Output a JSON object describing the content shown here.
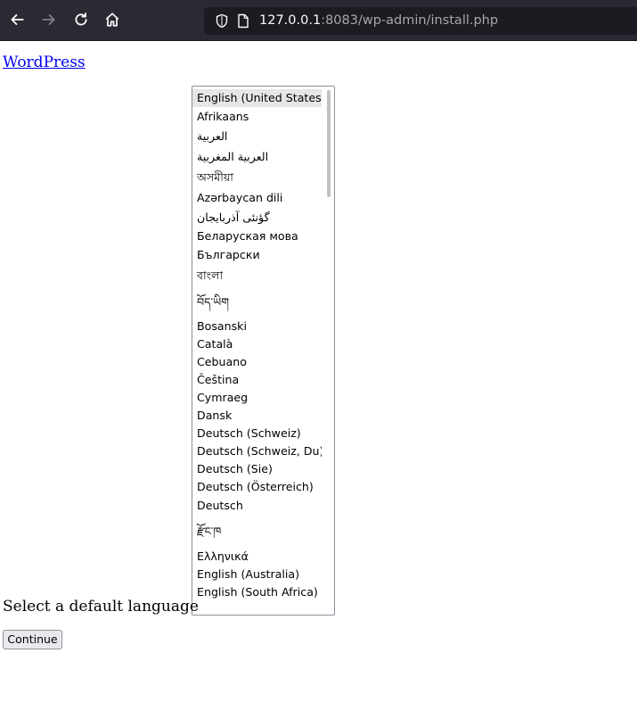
{
  "browser": {
    "url_host": "127.0.0.1",
    "url_rest": ":8083/wp-admin/install.php"
  },
  "page": {
    "site_link": "WordPress",
    "select_label": "Select a default language",
    "continue_label": "Continue"
  },
  "languages": {
    "items": [
      "English (United States)",
      "Afrikaans",
      "العربية",
      "العربية المغربية",
      "অসমীয়া",
      "Azərbaycan dili",
      "گؤنئی آذربایجان",
      "Беларуская мова",
      "Български",
      "বাংলা",
      "བོད་ཡིག",
      "Bosanski",
      "Català",
      "Cebuano",
      "Čeština",
      "Cymraeg",
      "Dansk",
      "Deutsch (Schweiz)",
      "Deutsch (Schweiz, Du)",
      "Deutsch (Sie)",
      "Deutsch (Österreich)",
      "Deutsch",
      "རྫོང་ཁ",
      "Ελληνικά",
      "English (Australia)",
      "English (South Africa)"
    ],
    "selected_index": 0
  },
  "icons": {
    "back": "arrow-left-icon",
    "forward": "arrow-right-icon",
    "reload": "reload-icon",
    "home": "home-icon",
    "shield": "shield-icon",
    "page": "page-icon"
  }
}
